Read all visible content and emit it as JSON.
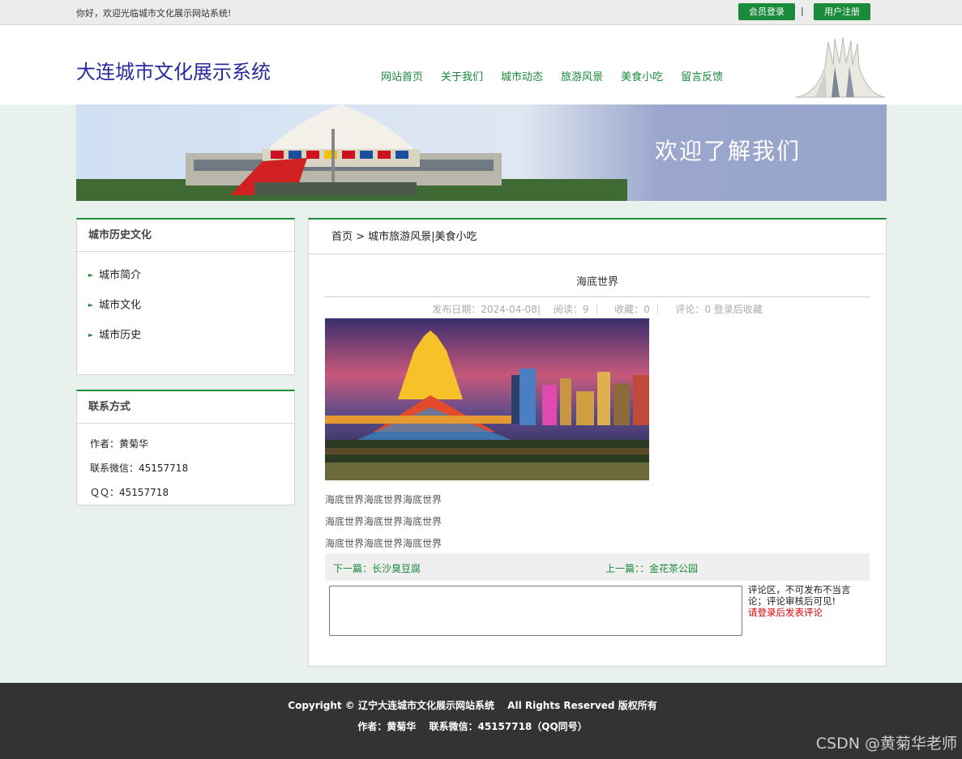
{
  "topbar": {
    "welcome": "你好，欢迎光临城市文化展示网站系统!",
    "login": "会员登录",
    "separator": "|",
    "register": "用户注册"
  },
  "header": {
    "site_title": "大连城市文化展示系统",
    "nav": [
      "网站首页",
      "关于我们",
      "城市动态",
      "旅游风景",
      "美食小吃",
      "留言反馈"
    ]
  },
  "banner": {
    "welcome": "欢迎了解我们"
  },
  "sidebar": {
    "history": {
      "title": "城市历史文化",
      "items": [
        "城市简介",
        "城市文化",
        "城市历史"
      ]
    },
    "contact": {
      "title": "联系方式",
      "rows": [
        "作者：黄菊华",
        "联系微信：45157718",
        "ＱＱ：45157718"
      ]
    }
  },
  "main": {
    "breadcrumb": "首页 > 城市旅游风景|美食小吃",
    "article_title": "海底世界",
    "meta": "发布日期：2024-04-08|　 阅读：9 ｜　 收藏：0 ｜　 评论：0 登录后收藏",
    "paragraphs": [
      "海底世界海底世界海底世界",
      "海底世界海底世界海底世界",
      "海底世界海底世界海底世界"
    ],
    "next": "下一篇：长沙臭豆腐",
    "prev": "上一篇：：金花茶公园",
    "comment_note": "评论区，不可发布不当言论；评论审核后可见!",
    "comment_login": "请登录后发表评论"
  },
  "footer": {
    "line1": "Copyright © 辽宁大连城市文化展示网站系统　 All Rights Reserved 版权所有",
    "line2": "作者：黄菊华　 联系微信：45157718（QQ同号）"
  },
  "watermark": "CSDN @黄菊华老师",
  "colors": {
    "accent": "#1a8a3b",
    "title": "#2a2a9e",
    "footer_bg": "#333333",
    "page_bg": "#e8f1ec"
  }
}
